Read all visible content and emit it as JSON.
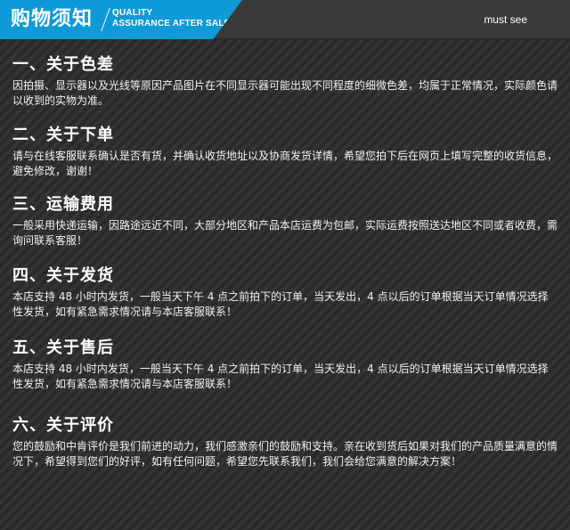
{
  "header": {
    "title": "购物须知",
    "sub_line1": "QUALITY",
    "sub_line2": "ASSURANCE AFTER SALE",
    "must_see": "must see",
    "accent_color": "#0e9ad6"
  },
  "sections": [
    {
      "title": "一、关于色差",
      "body": "因拍摄、显示器以及光线等原因产品图片在不同显示器可能出现不同程度的细微色差，均属于正常情况，实际颜色请以收到的实物为准。"
    },
    {
      "title": "二、关于下单",
      "body": "请与在线客服联系确认是否有货，并确认收货地址以及协商发货详情，希望您拍下后在网页上填写完整的收货信息，避免修改，谢谢！"
    },
    {
      "title": "三、运输费用",
      "body": "一般采用快递运输，因路途远近不同，大部分地区和产品本店运费为包邮，实际运费按照送达地区不同或者收费，需询问联系客服！"
    },
    {
      "title": "四、关于发货",
      "body": "本店支持 48 小时内发货，一般当天下午 4 点之前拍下的订单，当天发出，4 点以后的订单根据当天订单情况选择性发货，如有紧急需求情况请与本店客服联系！"
    },
    {
      "title": "五、关于售后",
      "body": "本店支持 48 小时内发货，一般当天下午 4 点之前拍下的订单，当天发出，4 点以后的订单根据当天订单情况选择性发货，如有紧急需求情况请与本店客服联系！"
    },
    {
      "title": "六、关于评价",
      "body": "您的鼓励和中肯评价是我们前进的动力，我们感激亲们的鼓励和支持。亲在收到货后如果对我们的产品质量满意的情况下，希望得到您们的好评，如有任何问题，希望您先联系我们，我们会给您满意的解决方案！"
    }
  ]
}
